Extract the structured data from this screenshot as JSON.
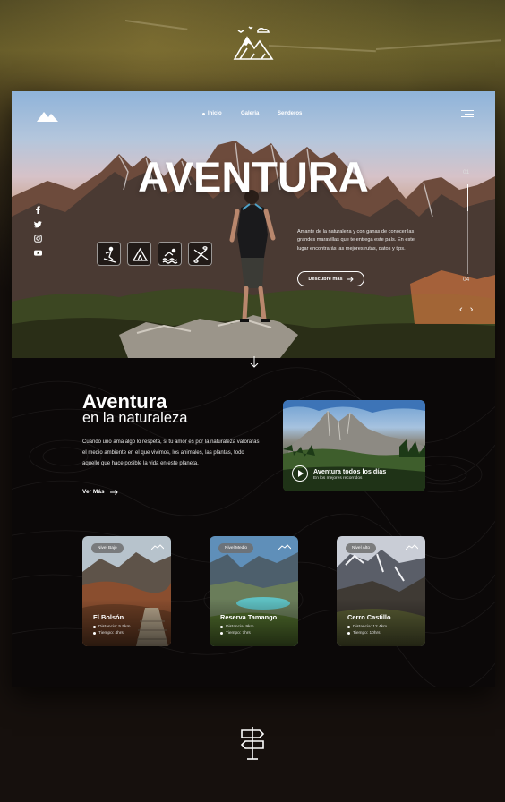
{
  "nav": {
    "items": [
      "Inicio",
      "Galeria",
      "Senderos"
    ]
  },
  "hero": {
    "title": "AVENTURA",
    "description": "Amante de la naturaleza y con ganas de conocer las grandes maravillas que te entrega este país. En este lugar encontrarás las mejores rutas, datos y tips.",
    "cta": "Descubre más",
    "slide_start": "01",
    "slide_end": "04"
  },
  "intro": {
    "title": "Aventura",
    "subtitle": "en la naturaleza",
    "text": "Cuando uno ama algo lo respeta, si tu amor es por la naturaleza valoraras el medio ambiente en el que vivimos, los animales, las plantas, todo aquello que hace posible la vida en este planeta.",
    "link": "Ver Más"
  },
  "feature": {
    "title": "Aventura todos los días",
    "subtitle": "En los mejores recorridos"
  },
  "trails": [
    {
      "level": "Nivel Bajo",
      "name": "El Bolsón",
      "distance": "Distancia: 5.5km",
      "time": "Tiempo: 4hrs"
    },
    {
      "level": "Nivel Medio",
      "name": "Reserva Tamango",
      "distance": "Distancia: 9km",
      "time": "Tiempo: 7hrs"
    },
    {
      "level": "Nivel Alto",
      "name": "Cerro Castillo",
      "distance": "Distancia: 12.4km",
      "time": "Tiempo: 10hrs"
    }
  ],
  "social_icons": [
    "facebook-icon",
    "twitter-icon",
    "instagram-icon",
    "youtube-icon"
  ],
  "activity_icons": [
    "skiing-icon",
    "camping-icon",
    "swimming-icon",
    "kayak-icon"
  ],
  "colors": {
    "background": "#16100d",
    "card": "#0b0808",
    "accent": "#ffffff"
  }
}
